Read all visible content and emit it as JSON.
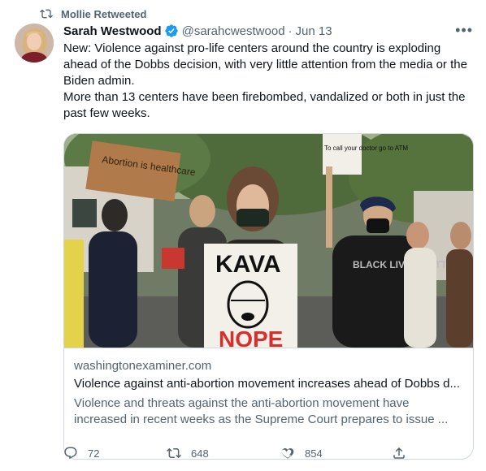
{
  "retweet_label": "Mollie Retweeted",
  "author": {
    "name": "Sarah Westwood",
    "handle": "@sarahcwestwood",
    "separator": "·",
    "date": "Jun 13"
  },
  "more_label": "•••",
  "tweet": {
    "line1": "New: Violence against pro-life centers around the country is exploding ahead of the Dobbs decision, with very little attention from the media or the Biden admin.",
    "line2": "More than 13 centers have been firebombed, vandalized or both in just the past few weeks."
  },
  "card": {
    "domain": "washingtonexaminer.com",
    "title": "Violence against anti-abortion movement increases ahead of Dobbs d...",
    "description": "Violence and threats against the anti-abortion movement have increased in recent weeks as the Supreme Court prepares to issue ...",
    "image_signs": {
      "left_sign": "Abortion is healthcare",
      "center_sign_top": "KAVA",
      "center_sign_bottom": "NOPE",
      "right_sign": "To call your doctor go to ATM",
      "shirt": "BLACK LIVES MATTER"
    }
  },
  "stats": {
    "replies": "72",
    "retweets": "648",
    "likes": "854"
  },
  "colors": {
    "verified": "#1d9bf0",
    "secondary_text": "#536471",
    "border": "#cfd9de"
  }
}
